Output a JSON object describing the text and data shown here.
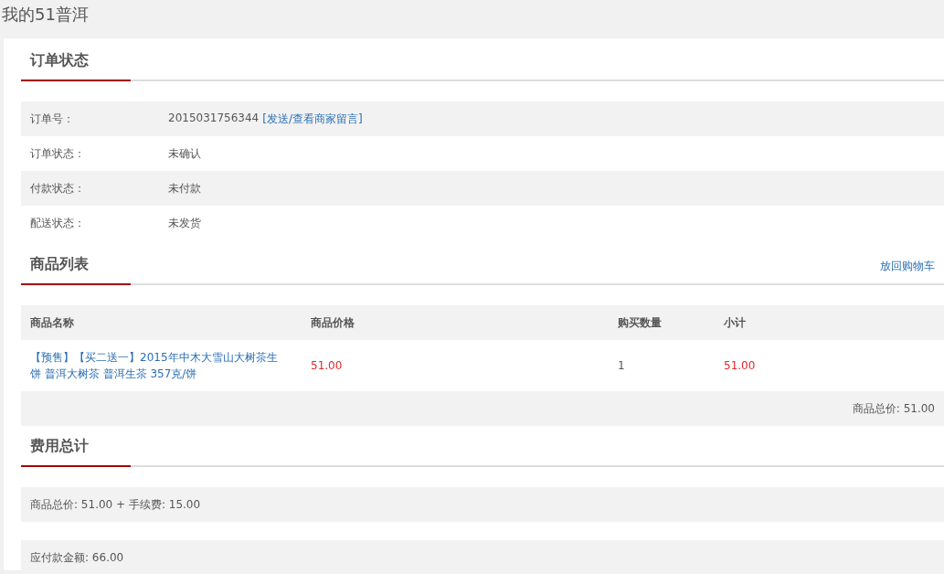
{
  "page_title": "我的51普洱",
  "order_status": {
    "heading": "订单状态",
    "rows": [
      {
        "label": "订单号：",
        "value": "2015031756344",
        "link": "[发送/查看商家留言]"
      },
      {
        "label": "订单状态：",
        "value": "未确认"
      },
      {
        "label": "付款状态：",
        "value": "未付款"
      },
      {
        "label": "配送状态：",
        "value": "未发货"
      }
    ]
  },
  "product_list": {
    "heading": "商品列表",
    "action": "放回购物车",
    "columns": [
      "商品名称",
      "商品价格",
      "购买数量",
      "小计"
    ],
    "rows": [
      {
        "cells": [
          {
            "kind": "link",
            "text": "【预售】【买二送一】2015年中木大雪山大树茶生饼 普洱大树茶 普洱生茶 357克/饼"
          },
          {
            "kind": "price",
            "text": "51.00"
          },
          {
            "kind": "text",
            "text": "1"
          },
          {
            "kind": "price",
            "text": "51.00"
          }
        ]
      }
    ],
    "total": "商品总价: 51.00"
  },
  "fee_total": {
    "heading": "费用总计",
    "lines": [
      "商品总价: 51.00 + 手续费: 15.00",
      "应付款金额: 66.00"
    ]
  }
}
